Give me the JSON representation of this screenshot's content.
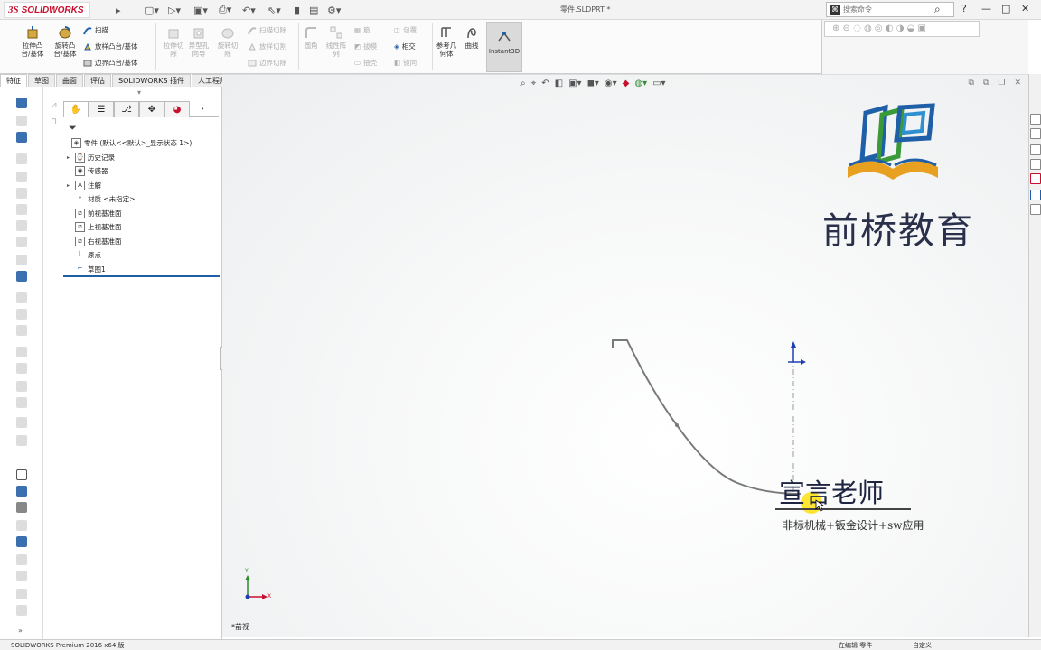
{
  "app": {
    "logo_ds": "3S",
    "logo_text": "SOLIDWORKS",
    "document_title": "零件.SLDPRT *",
    "search_placeholder": "搜索命令",
    "help_label": "?"
  },
  "command_manager": {
    "extrude_boss": "拉伸凸\n台/基体",
    "revolve_boss": "旋转凸\n台/基体",
    "sweep": "扫描",
    "loft": "放样凸台/基体",
    "boundary": "边界凸台/基体",
    "extrude_cut": "拉伸切\n除",
    "hole_wizard": "异型孔\n向导",
    "revolve_cut": "旋转切\n除",
    "swept_cut": "扫描切除",
    "lofted_cut": "放样切割",
    "boundary_cut": "边界切除",
    "fillet": "圆角",
    "linear_pattern": "线性阵\n列",
    "rib": "筋",
    "draft": "拔模",
    "shell": "抽壳",
    "wrap": "包覆",
    "intersect": "相交",
    "mirror": "镜向",
    "reference_geometry": "参考几\n何体",
    "curves": "曲线",
    "instant3d": "Instant3D"
  },
  "tabs": [
    "特征",
    "草图",
    "曲面",
    "评估",
    "SOLIDWORKS 插件",
    "人工程师"
  ],
  "active_tab_index": 0,
  "feature_tree": {
    "root": "零件 (默认<<默认>_显示状态 1>)",
    "items": [
      {
        "label": "历史记录",
        "icon": "history-icon",
        "expandable": true
      },
      {
        "label": "传感器",
        "icon": "sensor-icon",
        "expandable": false
      },
      {
        "label": "注解",
        "icon": "annotation-icon",
        "expandable": true
      },
      {
        "label": "材质 <未指定>",
        "icon": "material-icon",
        "expandable": false
      },
      {
        "label": "前视基准面",
        "icon": "plane-icon",
        "expandable": false
      },
      {
        "label": "上视基准面",
        "icon": "plane-icon",
        "expandable": false
      },
      {
        "label": "右视基准面",
        "icon": "plane-icon",
        "expandable": false
      },
      {
        "label": "原点",
        "icon": "origin-icon",
        "expandable": false
      },
      {
        "label": "草图1",
        "icon": "sketch-icon",
        "expandable": false
      }
    ]
  },
  "viewport": {
    "view_label": "*前视",
    "watermark_brand": "前桥教育",
    "watermark_teacher": "宣言老师",
    "watermark_tagline": "非标机械+钣金设计+sw应用",
    "axis_y": "Y",
    "axis_x": "X"
  },
  "status_bar": {
    "left": "SOLIDWORKS Premium 2016 x64 版",
    "middle": "在编辑 零件",
    "right": "自定义"
  },
  "colors": {
    "brand_red": "#c8102e",
    "accent_blue": "#1f5fa8",
    "sketch_gray": "#7a7a7a",
    "highlight_yellow": "#ffe000"
  }
}
